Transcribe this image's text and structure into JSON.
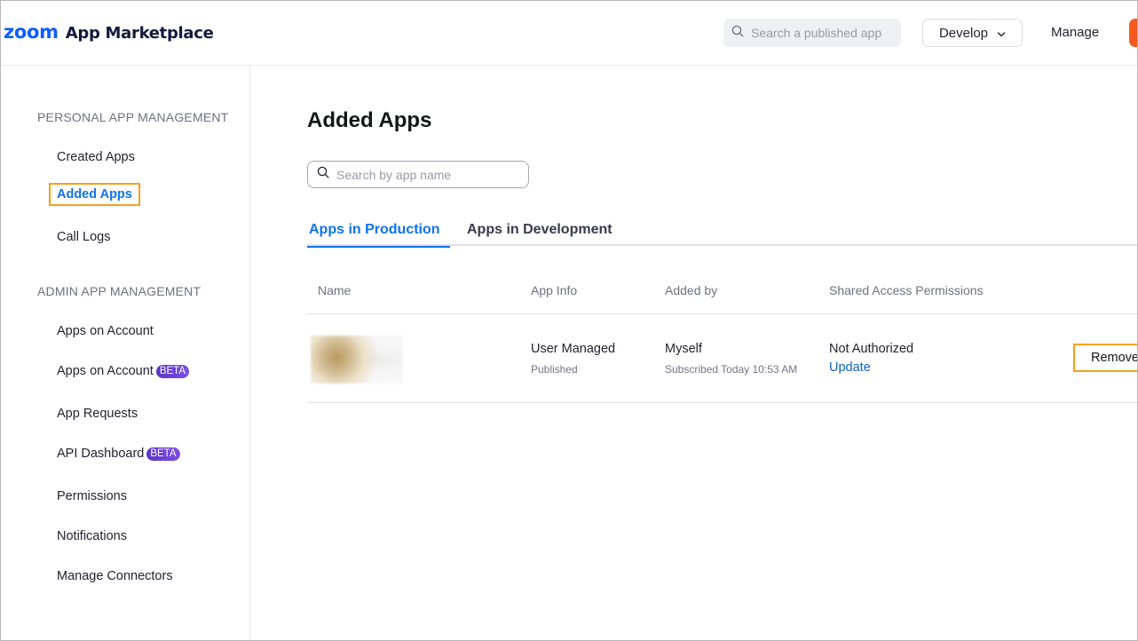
{
  "header": {
    "logo_brand": "zoom",
    "logo_text": "App Marketplace",
    "search_placeholder": "Search a published app",
    "develop_label": "Develop",
    "manage_label": "Manage",
    "accent_color": "#0b5cff",
    "cta_color": "#f4591e"
  },
  "sidebar": {
    "personal_title": "PERSONAL APP MANAGEMENT",
    "personal_items": [
      {
        "label": "Created Apps"
      },
      {
        "label": "Added Apps",
        "active": true
      },
      {
        "label": "Call Logs"
      }
    ],
    "admin_title": "ADMIN APP MANAGEMENT",
    "admin_items": [
      {
        "label": "Apps on Account"
      },
      {
        "label": "Apps on Account",
        "badge": "BETA"
      },
      {
        "label": "App Requests"
      },
      {
        "label": "API Dashboard",
        "badge": "BETA"
      },
      {
        "label": "Permissions"
      },
      {
        "label": "Notifications"
      },
      {
        "label": "Manage Connectors"
      }
    ]
  },
  "main": {
    "title": "Added Apps",
    "search_placeholder": "Search by app name",
    "tabs": [
      {
        "label": "Apps in Production",
        "active": true
      },
      {
        "label": "Apps in Development"
      }
    ],
    "table": {
      "columns": [
        "Name",
        "App Info",
        "Added by",
        "Shared Access Permissions"
      ],
      "rows": [
        {
          "name": "",
          "app_info": "User Managed",
          "app_status": "Published",
          "added_by": "Myself",
          "subscribed": "Subscribed Today 10:53 AM",
          "permission": "Not Authorized",
          "permission_action": "Update",
          "action": "Remove"
        }
      ]
    }
  },
  "colors": {
    "active_link": "#0e72ed",
    "highlight_outline": "#f7a118",
    "beta_badge": "#6a40d8"
  }
}
